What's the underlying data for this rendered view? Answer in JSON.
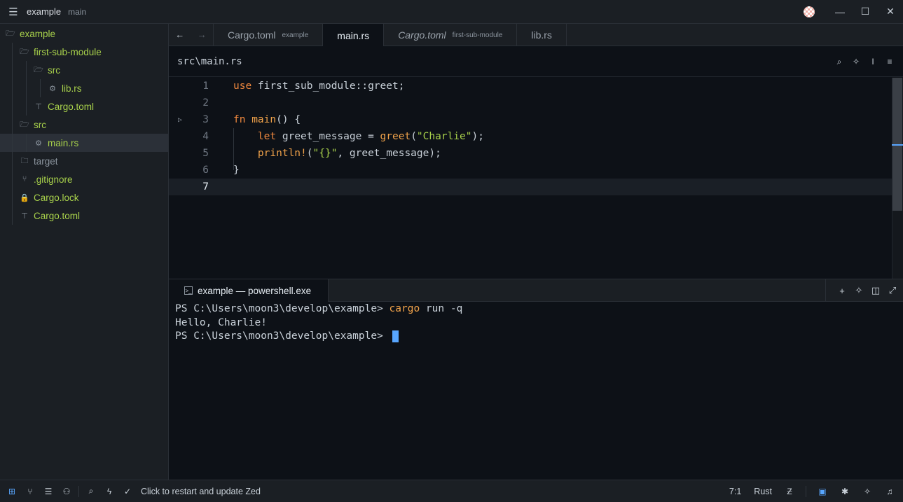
{
  "titlebar": {
    "project": "example",
    "branch": "main",
    "menu_icon": "hamburger-icon",
    "minimize": "—",
    "maximize": "☐",
    "close": "✕"
  },
  "sidebar": {
    "items": [
      {
        "label": "example",
        "icon": "folder-open-icon",
        "depth": 0,
        "state": ""
      },
      {
        "label": "first-sub-module",
        "icon": "folder-open-icon",
        "depth": 1,
        "state": ""
      },
      {
        "label": "src",
        "icon": "folder-open-icon",
        "depth": 2,
        "state": ""
      },
      {
        "label": "lib.rs",
        "icon": "rust-file-icon",
        "depth": 3,
        "state": ""
      },
      {
        "label": "Cargo.toml",
        "icon": "toml-file-icon",
        "depth": 2,
        "state": ""
      },
      {
        "label": "src",
        "icon": "folder-open-icon",
        "depth": 1,
        "state": ""
      },
      {
        "label": "main.rs",
        "icon": "rust-file-icon",
        "depth": 2,
        "state": "selected"
      },
      {
        "label": "target",
        "icon": "folder-icon",
        "depth": 1,
        "state": "dim"
      },
      {
        "label": ".gitignore",
        "icon": "git-icon",
        "depth": 1,
        "state": ""
      },
      {
        "label": "Cargo.lock",
        "icon": "lock-icon",
        "depth": 1,
        "state": ""
      },
      {
        "label": "Cargo.toml",
        "icon": "toml-file-icon",
        "depth": 1,
        "state": ""
      }
    ]
  },
  "tabs": [
    {
      "name": "Cargo.toml",
      "sub": "example",
      "active": false,
      "italic": false
    },
    {
      "name": "main.rs",
      "sub": "",
      "active": true,
      "italic": false
    },
    {
      "name": "Cargo.toml",
      "sub": "first-sub-module",
      "active": false,
      "italic": true
    },
    {
      "name": "lib.rs",
      "sub": "",
      "active": false,
      "italic": false
    }
  ],
  "breadcrumb": {
    "path": "src\\main.rs"
  },
  "editor": {
    "current_line": 7,
    "lines": [
      {
        "num": "1",
        "tokens": [
          [
            "kw",
            "use"
          ],
          [
            "",
            " first_sub_module::greet;"
          ]
        ]
      },
      {
        "num": "2",
        "tokens": []
      },
      {
        "num": "3",
        "run": true,
        "tokens": [
          [
            "kw",
            "fn"
          ],
          [
            "",
            " "
          ],
          [
            "fn",
            "main"
          ],
          [
            "",
            "() {"
          ]
        ]
      },
      {
        "num": "4",
        "tokens": [
          [
            "",
            "    "
          ],
          [
            "kw",
            "let"
          ],
          [
            "",
            " greet_message = "
          ],
          [
            "fn",
            "greet"
          ],
          [
            "",
            "("
          ],
          [
            "str",
            "\"Charlie\""
          ],
          [
            "",
            ");"
          ]
        ]
      },
      {
        "num": "5",
        "tokens": [
          [
            "",
            "    "
          ],
          [
            "fn",
            "println!"
          ],
          [
            "",
            "("
          ],
          [
            "str",
            "\"{}\""
          ],
          [
            "",
            ", greet_message);"
          ]
        ]
      },
      {
        "num": "6",
        "tokens": [
          [
            "",
            "}"
          ]
        ]
      },
      {
        "num": "7",
        "tokens": []
      }
    ]
  },
  "terminal": {
    "tab_title": "example — powershell.exe",
    "lines": [
      {
        "prompt": "PS C:\\Users\\moon3\\develop\\example> ",
        "cmd": "cargo",
        "args": " run -q"
      },
      {
        "prompt": "Hello, Charlie!",
        "cmd": "",
        "args": ""
      },
      {
        "prompt": "PS C:\\Users\\moon3\\develop\\example> ",
        "cmd": "",
        "args": "",
        "cursor": true
      }
    ]
  },
  "statusbar": {
    "message": "Click to restart and update Zed",
    "position": "7:1",
    "language": "Rust"
  },
  "colors": {
    "accent": "#58a6ff",
    "file_green": "#a8d14b",
    "keyword": "#f0883e"
  }
}
